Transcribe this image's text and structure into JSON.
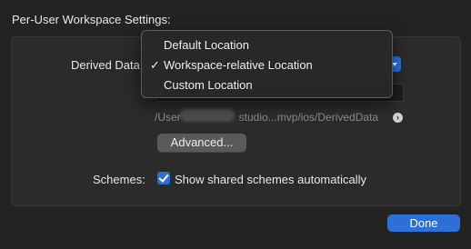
{
  "section_title": "Per-User Workspace Settings:",
  "derived_data": {
    "label": "Derived Data:",
    "path_display": "/User",
    "path_tail": "studio...mvp/ios/DerivedData"
  },
  "popup_menu": {
    "items": [
      {
        "label": "Default Location",
        "checked": false
      },
      {
        "label": "Workspace-relative Location",
        "checked": true
      },
      {
        "label": "Custom Location",
        "checked": false
      }
    ],
    "check_glyph": "✓"
  },
  "advanced_button": "Advanced...",
  "schemes": {
    "label": "Schemes:",
    "checkbox_label": "Show shared schemes automatically",
    "checked": true
  },
  "done_button": "Done",
  "icons": {
    "reveal": "arrow-right-circle-icon",
    "popup": "chevron-down-icon",
    "checkbox": "checkmark-icon"
  },
  "colors": {
    "accent": "#2f6fd8",
    "background": "#232323",
    "group_box": "#2b2b2b"
  }
}
